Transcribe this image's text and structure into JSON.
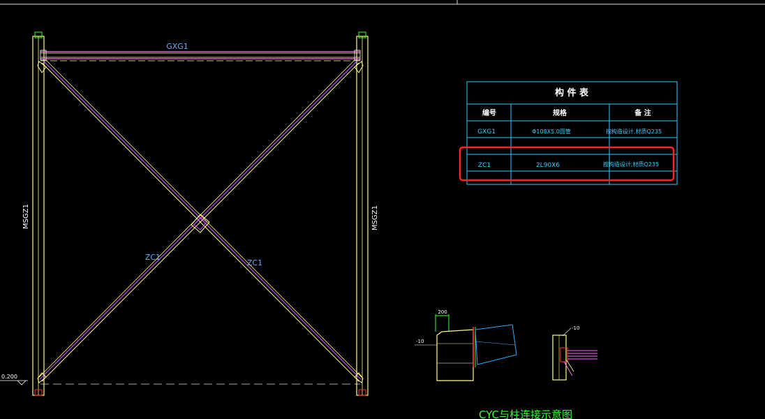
{
  "labels": {
    "top_beam": "GXG1",
    "left_column": "MSGZ1",
    "right_column": "MSGZ1",
    "brace_left": "ZC1",
    "brace_right": "ZC1",
    "elevation": "0.200",
    "detail_top_dim": "200",
    "detail_left_tag": "-10",
    "detail_right_tag": "-10",
    "detail_caption": "CYC与柱连接示意图"
  },
  "table": {
    "title": "构  件  表",
    "headers": [
      "编号",
      "规格",
      "备  注"
    ],
    "rows": [
      {
        "id": "GXG1",
        "spec": "Φ108X5.0圆管",
        "note": "按构造设计,材质Q235"
      },
      {
        "id": "ZC1",
        "spec": "2L90X6",
        "note": "按构造设计,材质Q235"
      }
    ]
  },
  "colors": {
    "background": "#000000",
    "column": "#ffff80",
    "beam": "#ff66ff",
    "brace_a": "#ffff80",
    "brace_b": "#cc44ff",
    "table_line": "#33ccff",
    "table_text": "#33ccff",
    "header_text": "#ffffff",
    "highlight": "#ff2222",
    "label_blue": "#66aaff",
    "label_white": "#ffffff",
    "green": "#33ff33",
    "cyan": "#33aaff"
  }
}
